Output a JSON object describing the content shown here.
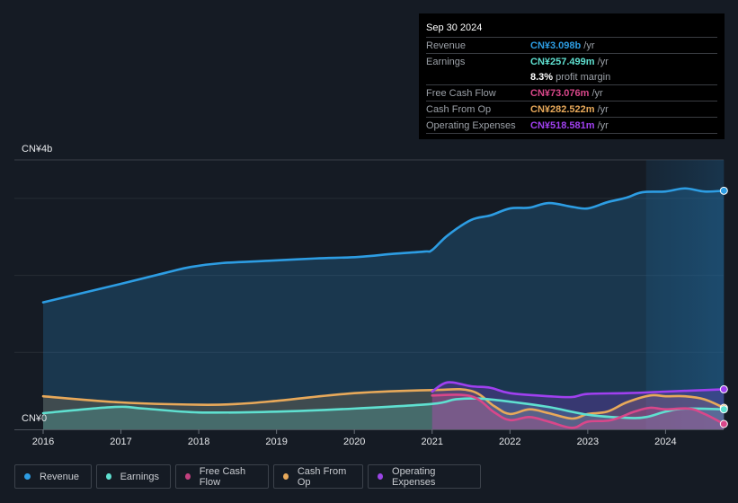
{
  "tooltip": {
    "date": "Sep 30 2024",
    "rows": [
      {
        "label": "Revenue",
        "value": "CN¥3.098b",
        "unit": "/yr",
        "color": "#2d9de3"
      },
      {
        "label": "Earnings",
        "value": "CN¥257.499m",
        "unit": "/yr",
        "color": "#5fe0d0"
      },
      {
        "label": "",
        "value": "8.3%",
        "unit": "profit margin",
        "color": "#ffffff"
      },
      {
        "label": "Free Cash Flow",
        "value": "CN¥73.076m",
        "unit": "/yr",
        "color": "#d9478a"
      },
      {
        "label": "Cash From Op",
        "value": "CN¥282.522m",
        "unit": "/yr",
        "color": "#e8a95a"
      },
      {
        "label": "Operating Expenses",
        "value": "CN¥518.581m",
        "unit": "/yr",
        "color": "#a040f0"
      }
    ]
  },
  "legend": [
    {
      "label": "Revenue",
      "color": "#2d9de3"
    },
    {
      "label": "Earnings",
      "color": "#5fe0d0"
    },
    {
      "label": "Free Cash Flow",
      "color": "#c2407e"
    },
    {
      "label": "Cash From Op",
      "color": "#e8a95a"
    },
    {
      "label": "Operating Expenses",
      "color": "#9b45e6"
    }
  ],
  "chart_data": {
    "type": "area",
    "title": "",
    "xlabel": "",
    "ylabel": "",
    "y_unit": "CN¥ billions",
    "y_top_label": "CN¥4b",
    "y_zero_label": "CN¥0",
    "ylim": [
      0,
      3.5
    ],
    "xlim": [
      2016,
      2024.75
    ],
    "x_ticks": [
      "2016",
      "2017",
      "2018",
      "2019",
      "2020",
      "2021",
      "2022",
      "2023",
      "2024"
    ],
    "gridlines": [
      1,
      2,
      3,
      3.5
    ],
    "highlight_range": [
      2023.75,
      2024.75
    ],
    "grid": true,
    "legend_position": "bottom-left",
    "series": [
      {
        "name": "Revenue",
        "color": "#2d9de3",
        "x": [
          2016.0,
          2017.0,
          2017.6,
          2017.9,
          2018.3,
          2018.9,
          2019.5,
          2020.05,
          2020.5,
          2020.9,
          2021.0,
          2021.2,
          2021.5,
          2021.75,
          2022.0,
          2022.25,
          2022.5,
          2022.8,
          2023.0,
          2023.25,
          2023.5,
          2023.7,
          2024.0,
          2024.25,
          2024.5,
          2024.75
        ],
        "y": [
          1.65,
          1.89,
          2.04,
          2.11,
          2.16,
          2.19,
          2.22,
          2.24,
          2.28,
          2.31,
          2.33,
          2.52,
          2.72,
          2.78,
          2.87,
          2.88,
          2.94,
          2.89,
          2.87,
          2.95,
          3.01,
          3.08,
          3.09,
          3.13,
          3.09,
          3.1
        ]
      },
      {
        "name": "Cash From Op",
        "color": "#e8a95a",
        "x": [
          2016.0,
          2017.0,
          2018.0,
          2018.5,
          2019.0,
          2020.0,
          2021.0,
          2021.5,
          2021.8,
          2022.0,
          2022.25,
          2022.5,
          2022.8,
          2023.0,
          2023.25,
          2023.5,
          2023.8,
          2024.0,
          2024.25,
          2024.5,
          2024.75
        ],
        "y": [
          0.43,
          0.35,
          0.32,
          0.33,
          0.37,
          0.47,
          0.51,
          0.5,
          0.3,
          0.2,
          0.26,
          0.21,
          0.14,
          0.2,
          0.23,
          0.35,
          0.44,
          0.43,
          0.43,
          0.39,
          0.28
        ]
      },
      {
        "name": "Earnings",
        "color": "#5fe0d0",
        "x": [
          2016.0,
          2016.9,
          2017.3,
          2018.0,
          2019.0,
          2020.0,
          2021.0,
          2021.3,
          2021.6,
          2022.0,
          2022.5,
          2023.0,
          2023.5,
          2023.75,
          2024.0,
          2024.25,
          2024.75
        ],
        "y": [
          0.21,
          0.29,
          0.27,
          0.22,
          0.23,
          0.27,
          0.33,
          0.39,
          0.4,
          0.36,
          0.29,
          0.19,
          0.15,
          0.16,
          0.23,
          0.27,
          0.26
        ]
      },
      {
        "name": "Operating Expenses",
        "color": "#a040f0",
        "x": [
          2021.0,
          2021.2,
          2021.5,
          2021.75,
          2022.0,
          2022.5,
          2022.8,
          2023.0,
          2023.5,
          2024.0,
          2024.75
        ],
        "y": [
          0.49,
          0.61,
          0.56,
          0.54,
          0.47,
          0.43,
          0.42,
          0.46,
          0.47,
          0.49,
          0.52
        ]
      },
      {
        "name": "Free Cash Flow",
        "color": "#d9478a",
        "x": [
          2021.0,
          2021.5,
          2021.8,
          2022.0,
          2022.25,
          2022.5,
          2022.8,
          2023.0,
          2023.3,
          2023.6,
          2023.8,
          2024.0,
          2024.3,
          2024.5,
          2024.75
        ],
        "y": [
          0.44,
          0.43,
          0.22,
          0.12,
          0.16,
          0.1,
          0.02,
          0.1,
          0.12,
          0.23,
          0.28,
          0.26,
          0.27,
          0.2,
          0.07
        ]
      }
    ]
  }
}
